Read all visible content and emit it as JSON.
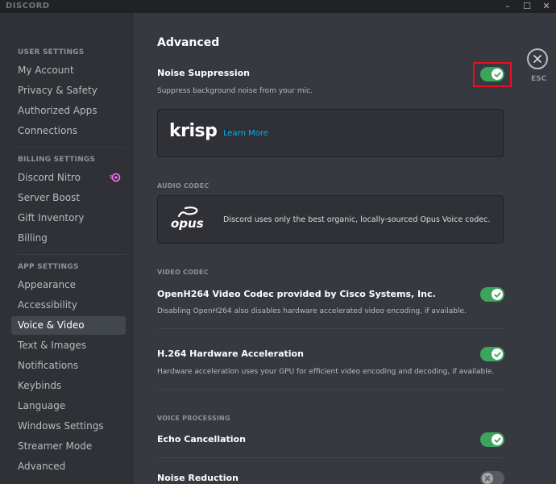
{
  "app": {
    "name": "DISCORD"
  },
  "window_controls": {
    "minimize": "–",
    "maximize": "☐",
    "close": "✕"
  },
  "sidebar": {
    "user_settings_header": "USER SETTINGS",
    "user_items": [
      "My Account",
      "Privacy & Safety",
      "Authorized Apps",
      "Connections"
    ],
    "billing_header": "BILLING SETTINGS",
    "billing_items": [
      "Discord Nitro",
      "Server Boost",
      "Gift Inventory",
      "Billing"
    ],
    "app_header": "APP SETTINGS",
    "app_items": [
      "Appearance",
      "Accessibility",
      "Voice & Video",
      "Text & Images",
      "Notifications",
      "Keybinds",
      "Language",
      "Windows Settings",
      "Streamer Mode",
      "Advanced"
    ],
    "selected": "Voice & Video"
  },
  "main": {
    "title": "Advanced",
    "noise_suppression": {
      "label": "Noise Suppression",
      "desc": "Suppress background noise from your mic.",
      "enabled": true
    },
    "krisp": {
      "logo": "krisp",
      "link": "Learn More"
    },
    "audio_codec": {
      "header": "AUDIO CODEC",
      "logo": "opus",
      "desc": "Discord uses only the best organic, locally-sourced Opus Voice codec."
    },
    "video_codec": {
      "header": "VIDEO CODEC",
      "openh264": {
        "label": "OpenH264 Video Codec provided by Cisco Systems, Inc.",
        "desc": "Disabling OpenH264 also disables hardware accelerated video encoding, if available.",
        "enabled": true
      },
      "h264_hw": {
        "label": "H.264 Hardware Acceleration",
        "desc": "Hardware acceleration uses your GPU for efficient video encoding and decoding, if available.",
        "enabled": true
      }
    },
    "voice_processing": {
      "header": "VOICE PROCESSING",
      "echo": {
        "label": "Echo Cancellation",
        "enabled": true
      },
      "noise_reduction": {
        "label": "Noise Reduction",
        "enabled": false
      }
    },
    "close": {
      "label": "ESC"
    }
  },
  "colors": {
    "accent_green": "#3ba55d",
    "highlight_red": "#e81123",
    "link_blue": "#00b0f4",
    "nitro_pink": "#ff73fa"
  }
}
